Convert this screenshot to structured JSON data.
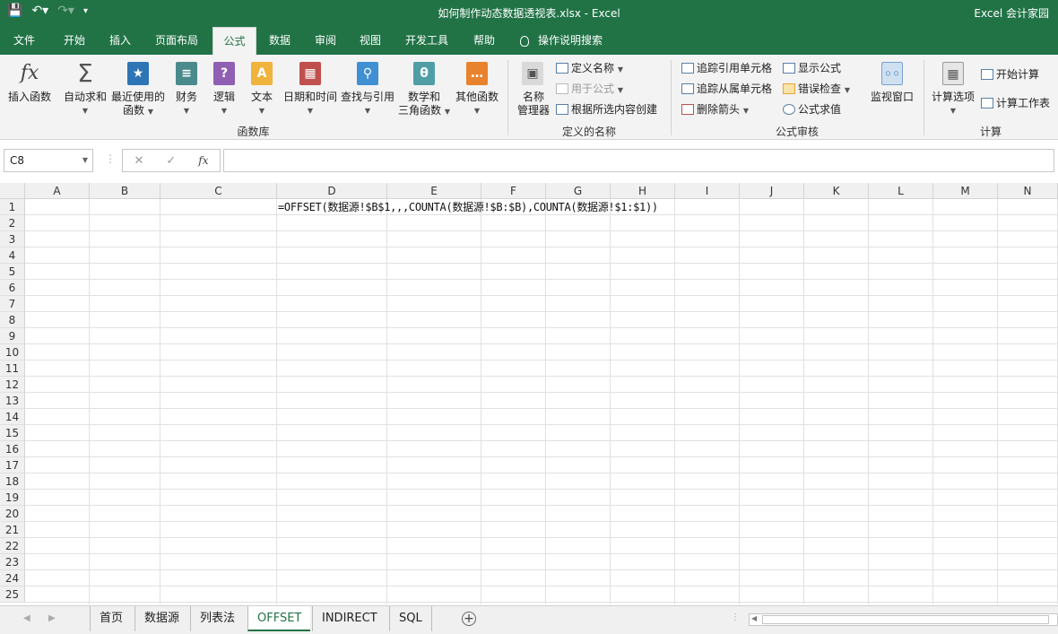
{
  "window": {
    "title": "如何制作动态数据透视表.xlsx  -  Excel",
    "brand": "Excel 会计家园"
  },
  "tabs": [
    "文件",
    "开始",
    "插入",
    "页面布局",
    "公式",
    "数据",
    "审阅",
    "视图",
    "开发工具",
    "帮助"
  ],
  "tell_me": "操作说明搜索",
  "ribbon": {
    "insert_function": "插入函数",
    "autosum": "自动求和",
    "recent_1": "最近使用的",
    "recent_2": "函数",
    "financial": "财务",
    "logical": "逻辑",
    "text": "文本",
    "datetime": "日期和时间",
    "lookup": "查找与引用",
    "math_1": "数学和",
    "math_2": "三角函数",
    "more": "其他函数",
    "group_library": "函数库",
    "name_mgr_1": "名称",
    "name_mgr_2": "管理器",
    "define_name": "定义名称",
    "use_in_formula": "用于公式",
    "create_from_sel": "根据所选内容创建",
    "group_names": "定义的名称",
    "trace_precedents": "追踪引用单元格",
    "trace_dependents": "追踪从属单元格",
    "remove_arrows": "删除箭头",
    "show_formulas": "显示公式",
    "error_check": "错误检查",
    "evaluate": "公式求值",
    "watch": "监视窗口",
    "group_audit": "公式审核",
    "calc_options": "计算选项",
    "calc_now": "开始计算",
    "calc_sheet": "计算工作表",
    "group_calc": "计算"
  },
  "formula_bar": {
    "name_box": "C8",
    "fx": "fx",
    "value": ""
  },
  "grid": {
    "columns": [
      "A",
      "B",
      "C",
      "D",
      "E",
      "F",
      "G",
      "H",
      "I",
      "J",
      "K",
      "L",
      "M",
      "N"
    ],
    "rows": [
      "1",
      "2",
      "3",
      "4",
      "5",
      "6",
      "7",
      "8",
      "9",
      "10",
      "11",
      "12",
      "13",
      "14",
      "15",
      "16",
      "17",
      "18",
      "19",
      "20",
      "21",
      "22",
      "23",
      "24",
      "25"
    ],
    "d1": "=OFFSET(数据源!$B$1,,,COUNTA(数据源!$B:$B),COUNTA(数据源!$1:$1))"
  },
  "sheets": [
    "首页",
    "数据源",
    "列表法",
    "OFFSET",
    "INDIRECT",
    "SQL"
  ],
  "active_sheet": "OFFSET",
  "colors": {
    "excel_green": "#217346"
  }
}
